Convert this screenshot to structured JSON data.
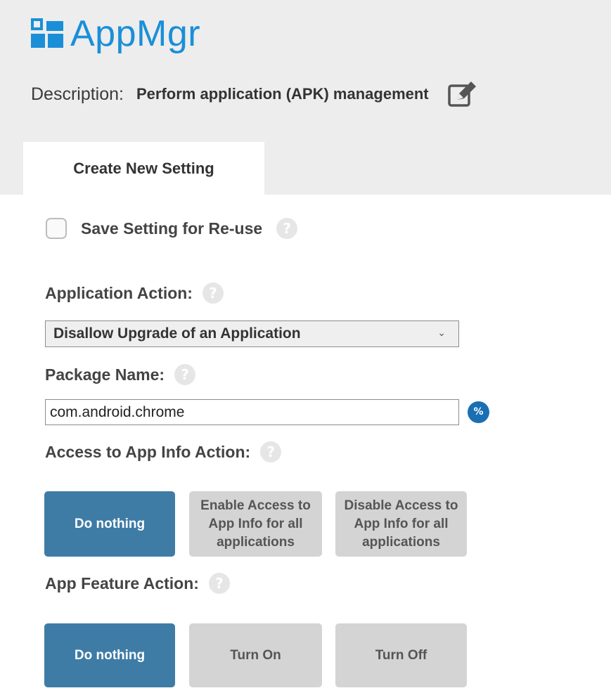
{
  "app": {
    "title": "AppMgr",
    "icon": "app-grid-icon",
    "accent_color": "#1a8fd8"
  },
  "description": {
    "label": "Description:",
    "text": "Perform application (APK) management",
    "edit_icon": "edit-icon"
  },
  "tabs": [
    {
      "label": "Create New Setting",
      "active": true
    }
  ],
  "save_setting": {
    "label": "Save Setting for Re-use",
    "checked": false,
    "help": "?"
  },
  "application_action": {
    "label": "Application Action:",
    "help": "?",
    "selected": "Disallow Upgrade of an Application"
  },
  "package_name": {
    "label": "Package Name:",
    "help": "?",
    "value": "com.android.chrome",
    "variable_icon": "%"
  },
  "app_info_action": {
    "label": "Access to App Info Action:",
    "help": "?",
    "options": [
      {
        "label": "Do nothing",
        "selected": true
      },
      {
        "label": "Enable Access to App Info for all applications",
        "selected": false
      },
      {
        "label": "Disable Access to App Info for all applications",
        "selected": false
      }
    ]
  },
  "app_feature_action": {
    "label": "App Feature Action:",
    "help": "?",
    "options": [
      {
        "label": "Do nothing",
        "selected": true
      },
      {
        "label": "Turn On",
        "selected": false
      },
      {
        "label": "Turn Off",
        "selected": false
      }
    ]
  },
  "colors": {
    "selected_button": "#3e7ca6",
    "unselected_button": "#d4d4d4",
    "header_background": "#ededed"
  }
}
